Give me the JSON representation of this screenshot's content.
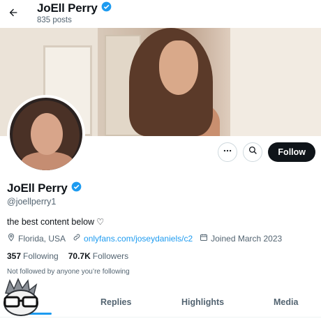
{
  "header": {
    "name": "JoEll Perry",
    "posts": "835 posts"
  },
  "profile": {
    "name": "JoEll Perry",
    "handle": "@joellperry1",
    "bio": "the best content below",
    "bio_symbol": "♡",
    "location": "Florida, USA",
    "link": "onlyfans.com/joseydaniels/c2",
    "joined": "Joined March 2023",
    "following_count": "357",
    "following_label": "Following",
    "followers_count": "70.7K",
    "followers_label": "Followers",
    "not_followed": "Not followed by anyone you’re following"
  },
  "actions": {
    "more_icon": "more-icon",
    "search_icon": "search-icon",
    "follow_label": "Follow"
  },
  "tabs": [
    {
      "label": "ts",
      "active": true
    },
    {
      "label": "Replies",
      "active": false
    },
    {
      "label": "Highlights",
      "active": false
    },
    {
      "label": "Media",
      "active": false
    }
  ],
  "colors": {
    "accent": "#1d9bf0",
    "text": "#0f1419",
    "muted": "#536471",
    "button": "#0f1419"
  }
}
